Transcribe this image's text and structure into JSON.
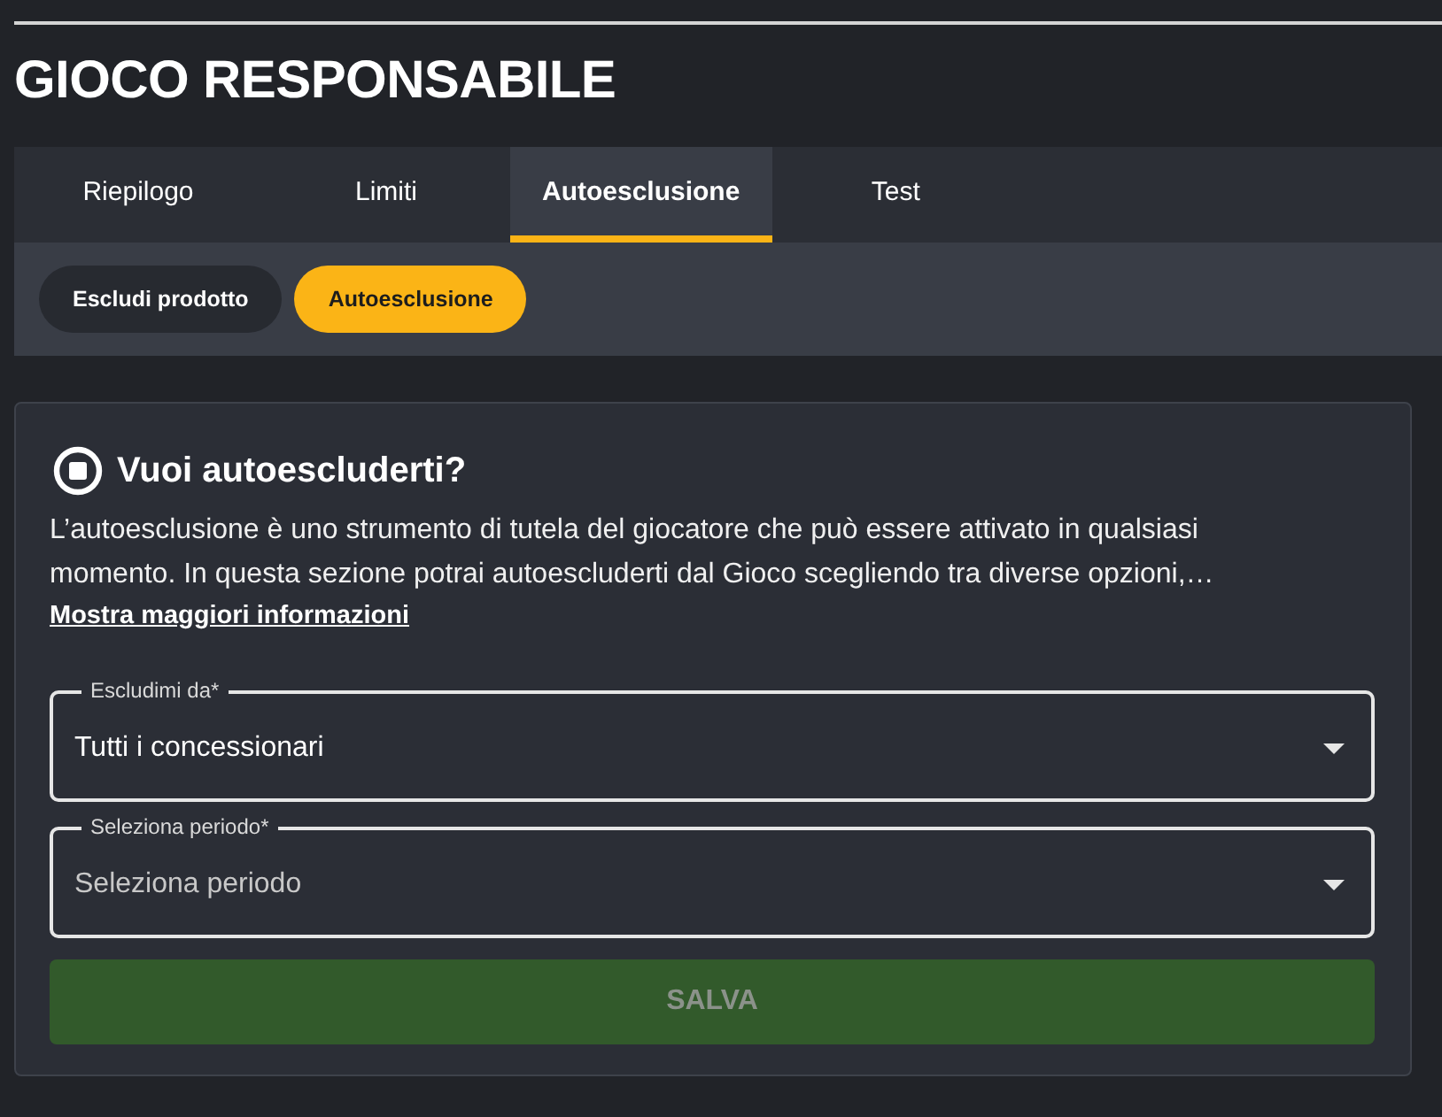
{
  "header": {
    "title": "GIOCO RESPONSABILE"
  },
  "tabs": [
    {
      "label": "Riepilogo",
      "selected": false
    },
    {
      "label": "Limiti",
      "selected": false
    },
    {
      "label": "Autoesclusione",
      "selected": true
    },
    {
      "label": "Test",
      "selected": false
    }
  ],
  "subtabs": [
    {
      "label": "Escludi prodotto",
      "selected": false
    },
    {
      "label": "Autoesclusione",
      "selected": true
    }
  ],
  "card": {
    "heading": "Vuoi autoescluderti?",
    "description": "L’autoesclusione è uno strumento di tutela del giocatore che può essere attivato in qualsiasi momento. In questa sezione potrai autoescluderti dal Gioco scegliendo tra diverse opzioni,…",
    "more_link": "Mostra maggiori informazioni",
    "fields": [
      {
        "label": "Escludimi da*",
        "value": "Tutti i concessionari"
      },
      {
        "label": "Seleziona periodo*",
        "placeholder": "Seleziona periodo"
      }
    ],
    "submit": {
      "label": "SALVA",
      "disabled": true
    }
  }
}
